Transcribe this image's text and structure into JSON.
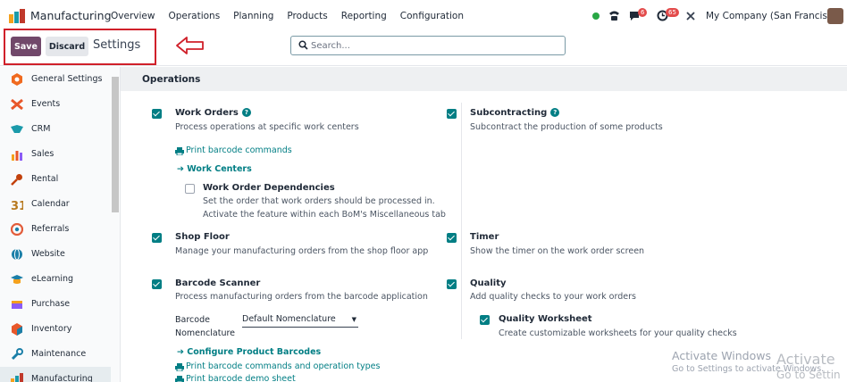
{
  "navbar": {
    "app_name": "Manufacturing",
    "menu": [
      "Overview",
      "Operations",
      "Planning",
      "Products",
      "Reporting",
      "Configuration"
    ],
    "chat_badge": "6",
    "activity_badge": "65",
    "company": "My Company (San Francisco)"
  },
  "control": {
    "save_label": "Save",
    "discard_label": "Discard",
    "title": "Settings",
    "search_placeholder": "Search..."
  },
  "sidebar": {
    "items": [
      {
        "label": "General Settings",
        "icon": "general-settings-icon",
        "color": "#f06a1f"
      },
      {
        "label": "Events",
        "icon": "events-icon",
        "color": "#e8572a"
      },
      {
        "label": "CRM",
        "icon": "crm-icon",
        "color": "#1b9aaa"
      },
      {
        "label": "Sales",
        "icon": "sales-icon",
        "color": "#f4a11d"
      },
      {
        "label": "Rental",
        "icon": "rental-icon",
        "color": "#c2410c"
      },
      {
        "label": "Calendar",
        "icon": "calendar-icon",
        "color": "#b7791f"
      },
      {
        "label": "Referrals",
        "icon": "referrals-icon",
        "color": "#e25c3a"
      },
      {
        "label": "Website",
        "icon": "website-icon",
        "color": "#1b7fa8"
      },
      {
        "label": "eLearning",
        "icon": "elearning-icon",
        "color": "#1b7fa8"
      },
      {
        "label": "Purchase",
        "icon": "purchase-icon",
        "color": "#8b5cf6"
      },
      {
        "label": "Inventory",
        "icon": "inventory-icon",
        "color": "#e8572a"
      },
      {
        "label": "Maintenance",
        "icon": "maintenance-icon",
        "color": "#1b7fa8"
      },
      {
        "label": "Manufacturing",
        "icon": "manufacturing-icon",
        "color": "#1b9aaa"
      }
    ]
  },
  "section": {
    "title": "Operations",
    "work_orders": {
      "title": "Work Orders",
      "desc": "Process operations at specific work centers",
      "print_link": "Print barcode commands",
      "work_centers_link": "Work Centers",
      "dependencies_title": "Work Order Dependencies",
      "dependencies_desc1": "Set the order that work orders should be processed in.",
      "dependencies_desc2": "Activate the feature within each BoM's Miscellaneous tab"
    },
    "subcontracting": {
      "title": "Subcontracting",
      "desc": "Subcontract the production of some products"
    },
    "shop_floor": {
      "title": "Shop Floor",
      "desc": "Manage your manufacturing orders from the shop floor app"
    },
    "timer": {
      "title": "Timer",
      "desc": "Show the timer on the work order screen"
    },
    "barcode": {
      "title": "Barcode Scanner",
      "desc": "Process manufacturing orders from the barcode application",
      "nomenclature_label_1": "Barcode",
      "nomenclature_label_2": "Nomenclature",
      "nomenclature_value": "Default Nomenclature",
      "configure_link": "Configure Product Barcodes",
      "print_ops_link": "Print barcode commands and operation types",
      "print_demo_link": "Print barcode demo sheet"
    },
    "quality": {
      "title": "Quality",
      "desc": "Add quality checks to your work orders",
      "worksheet_title": "Quality Worksheet",
      "worksheet_desc": "Create customizable worksheets for your quality checks"
    }
  },
  "watermark": {
    "line1": "Activate Windows",
    "line2": "Go to Settings to activate Windows.",
    "line3": "Activate",
    "line4": "Go to Settin"
  },
  "colors": {
    "primary": "#71486a",
    "accent": "#017e84",
    "highlight": "#d0202a"
  }
}
